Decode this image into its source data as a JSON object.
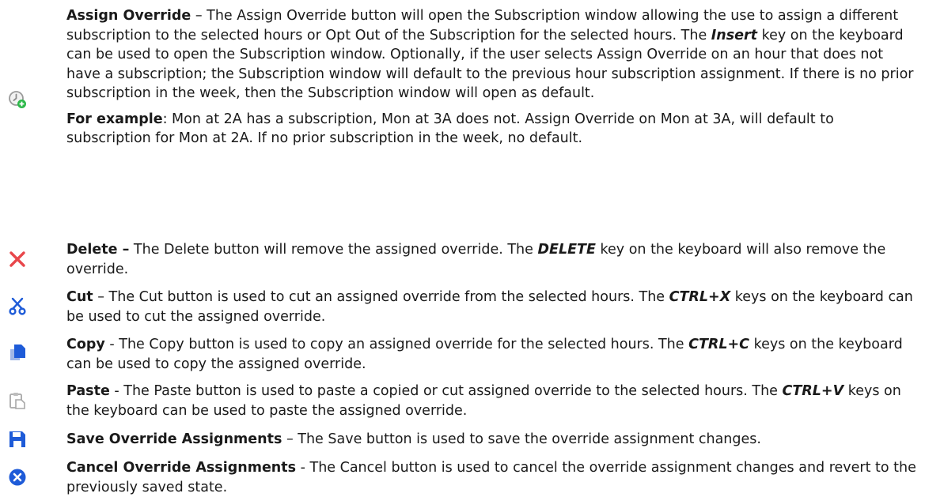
{
  "items": [
    {
      "icon": "clock-plus-icon",
      "title": "Assign Override",
      "sep": " – ",
      "text_before_key": "The Assign Override button will open the Subscription window allowing the use to assign a different subscription to the selected hours or Opt Out of the Subscription for the selected hours. The ",
      "key": "Insert",
      "text_after_key": " key on the keyboard can be used to open the Subscription window. Optionally, if the user selects Assign Override on an hour that does not have a subscription; the Subscription window will default to the previous hour subscription assignment. If there is no prior subscription in the week, then the Subscription window will open as default.",
      "example_label": "For example",
      "example_text": ": Mon at 2A has a subscription, Mon at 3A does not. Assign Override on Mon at 3A, will default to subscription for Mon at 2A. If no prior subscription in the week, no default."
    },
    {
      "icon": "delete-x-icon",
      "title": "Delete –",
      "text_before_key": " The Delete button will remove the assigned override. The ",
      "key": "DELETE",
      "text_after_key": " key on the keyboard will also remove the override."
    },
    {
      "icon": "scissors-icon",
      "title": "Cut",
      "text_before_key": " – The Cut button is used to cut an assigned override from the selected hours. The ",
      "key": "CTRL+X",
      "text_after_key": " keys on the keyboard can be used to cut the assigned override."
    },
    {
      "icon": "copy-icon",
      "title": "Copy",
      "text_before_key": " - The Copy button is used to copy an assigned override for the selected hours. The ",
      "key": "CTRL+C",
      "text_after_key": " keys on the keyboard can be used to copy the assigned override."
    },
    {
      "icon": "paste-icon",
      "title": "Paste",
      "text_before_key": " - The Paste button is used to paste a copied or cut assigned override to the selected hours. The ",
      "key": "CTRL+V",
      "text_after_key": " keys on the keyboard can be used to paste the assigned override."
    },
    {
      "icon": "save-disk-icon",
      "title": "Save Override Assignments",
      "text": " – The Save button is used to save the override assignment changes."
    },
    {
      "icon": "cancel-circle-icon",
      "title": "Cancel Override Assignments",
      "text": " - The Cancel button is used to cancel the override assignment changes and revert to the previously saved state."
    }
  ],
  "colors": {
    "text": "#1a1a1a",
    "delete_red": "#e8474b",
    "blue": "#1e5bd8",
    "gray": "#9a9a9a",
    "green": "#2db84a"
  }
}
